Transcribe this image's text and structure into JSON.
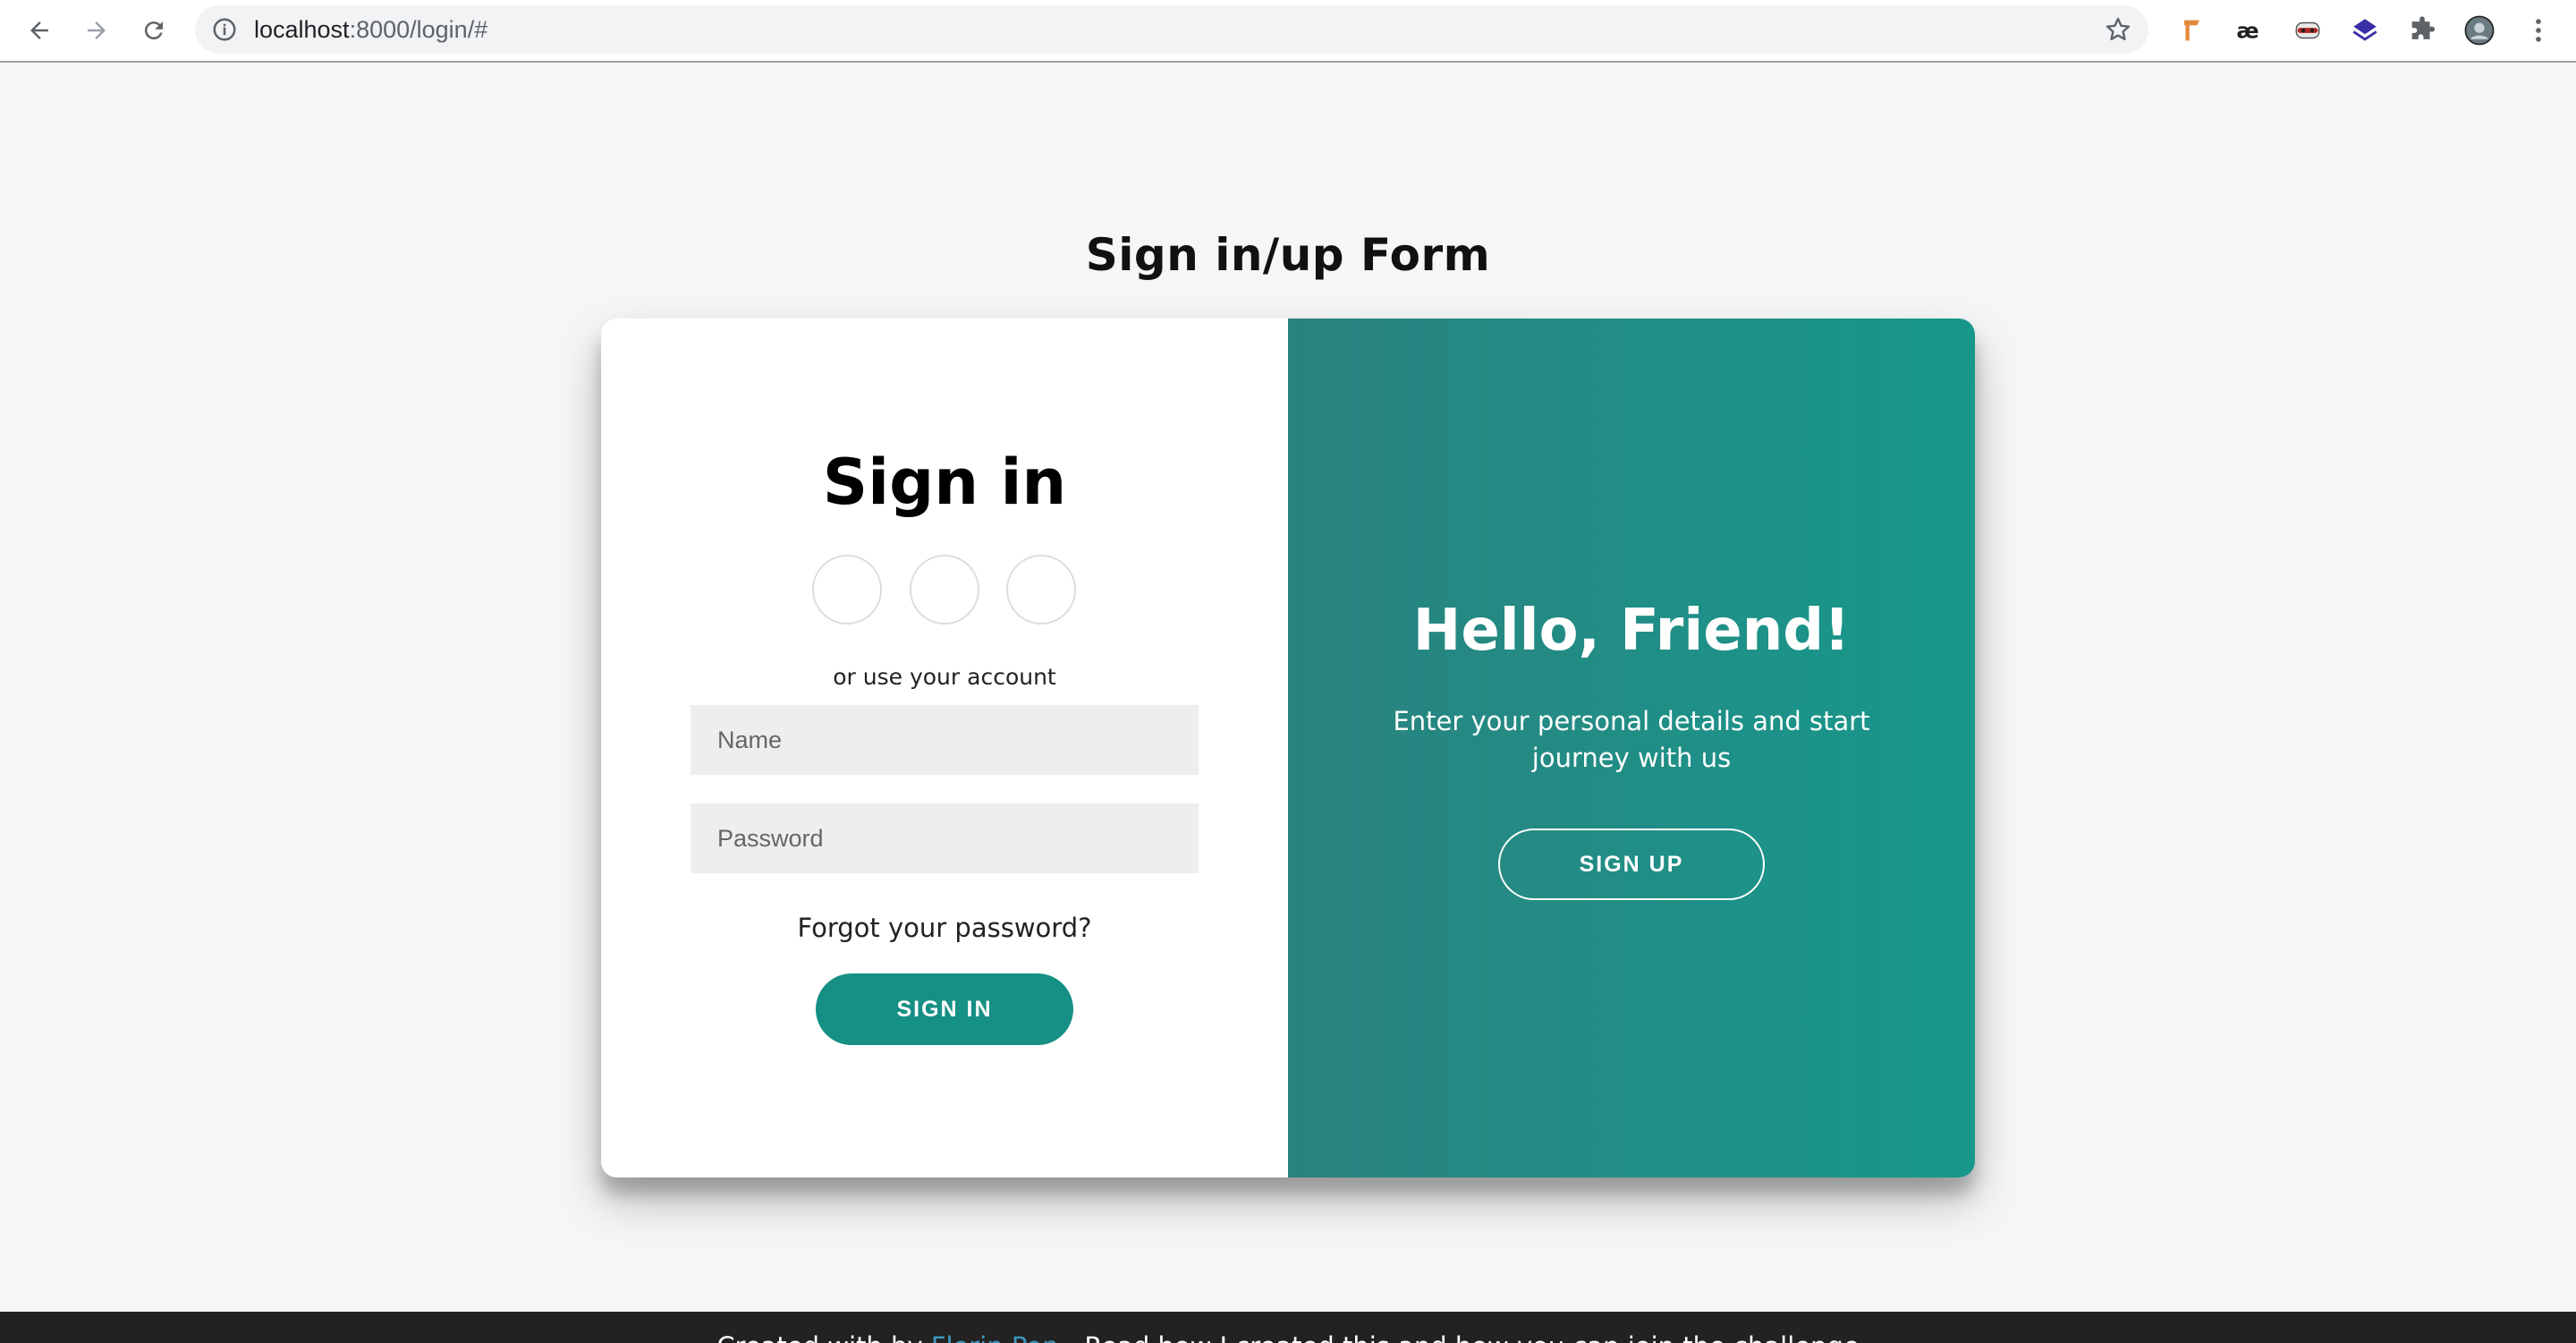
{
  "browser": {
    "url_host": "localhost",
    "url_rest": ":8000/login/#",
    "icons": [
      "back-icon",
      "forward-icon",
      "reload-icon",
      "info-icon",
      "star-icon",
      "extension-icon",
      "profile-avatar",
      "menu-dots-icon"
    ]
  },
  "page": {
    "title": "Sign in/up Form"
  },
  "signin": {
    "heading": "Sign in",
    "social_buttons": [
      "social-button-1",
      "social-button-2",
      "social-button-3"
    ],
    "or_text": "or use your account",
    "name_placeholder": "Name",
    "password_placeholder": "Password",
    "forgot": "Forgot your password?",
    "button": "SIGN IN"
  },
  "overlay": {
    "heading": "Hello, Friend!",
    "text": "Enter your personal details and start journey with us",
    "button": "SIGN UP"
  },
  "footer": {
    "prefix": "Created with by ",
    "link": "Florin Pop",
    "suffix": " - Read how I created this and how you can join the challenge "
  },
  "colors": {
    "accent": "#168f84",
    "page_bg": "#f5f6f8",
    "footer_bg": "#222222"
  }
}
